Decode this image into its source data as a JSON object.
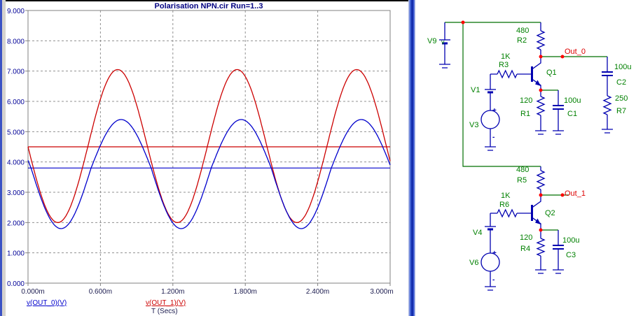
{
  "chart": {
    "title": "Polarisation NPN.cir Run=1..3",
    "x_axis_label": "T (Secs)",
    "legend": [
      {
        "label": "v(OUT_0)(V)",
        "color": "#0000cc"
      },
      {
        "label": "v(OUT_1)(V)",
        "color": "#cc0000"
      }
    ],
    "x_ticks": [
      "0.000m",
      "0.600m",
      "1.200m",
      "1.800m",
      "2.400m",
      "3.000m"
    ],
    "y_ticks": [
      "9.000",
      "8.000",
      "7.000",
      "6.000",
      "5.000",
      "4.000",
      "3.000",
      "2.000",
      "1.000",
      "0.000"
    ]
  },
  "chart_data": {
    "type": "line",
    "title": "Polarisation NPN.cir Run=1..3",
    "xlabel": "T (Secs)",
    "x_unit": "ms",
    "xlim": [
      0,
      3
    ],
    "ylim": [
      0,
      9
    ],
    "x_tick_step_ms": 0.6,
    "y_tick_step": 1.0,
    "grid": true,
    "legend_position": "bottom",
    "series": [
      {
        "name": "v(OUT_1)(V) bias (run 1)",
        "color": "#cc0000",
        "kind": "flat",
        "value_v": 4.5
      },
      {
        "name": "v(OUT_0)(V) bias (run 1)",
        "color": "#0000cc",
        "kind": "flat",
        "value_v": 3.8
      },
      {
        "name": "v(OUT_1)(V)",
        "color": "#cc0000",
        "kind": "sine",
        "mean_v": 4.5,
        "min_v": 2.0,
        "max_v": 7.05,
        "period_ms": 0.99,
        "t0_ms": 0,
        "peaks_ms": [
          0.74,
          1.73,
          2.72
        ],
        "troughs_ms": [
          0.25,
          1.24,
          2.23
        ]
      },
      {
        "name": "v(OUT_0)(V)",
        "color": "#0000cc",
        "kind": "sine",
        "mean_v": 3.8,
        "min_v": 1.8,
        "max_v": 5.4,
        "period_ms": 0.995,
        "t0_ms": 0.025,
        "peaks_ms": [
          0.77,
          1.77,
          2.76
        ],
        "troughs_ms": [
          0.27,
          1.27,
          2.26
        ]
      }
    ]
  },
  "schematic": {
    "plus_sign": "+",
    "minus_sign": "-",
    "v9": {
      "name": "V9",
      "suffix": "v"
    },
    "r2": {
      "value": "480",
      "name": "R2"
    },
    "r3": {
      "value": "1K",
      "name": "R3"
    },
    "q1": {
      "name": "Q1"
    },
    "r1": {
      "value": "120",
      "name": "R1"
    },
    "c1": {
      "value": "100u",
      "name": "C1"
    },
    "c2": {
      "value": "100u",
      "name": "C2"
    },
    "r7": {
      "value": "250",
      "name": "R7"
    },
    "v1": {
      "name": "V1"
    },
    "v3": {
      "name": "V3"
    },
    "out0": {
      "net": "Out_0"
    },
    "r5": {
      "value": "480",
      "name": "R5"
    },
    "r6": {
      "value": "1K",
      "name": "R6"
    },
    "q2": {
      "name": "Q2"
    },
    "r4": {
      "value": "120",
      "name": "R4"
    },
    "c3": {
      "value": "100u",
      "name": "C3"
    },
    "v4": {
      "name": "V4"
    },
    "v6": {
      "name": "V6"
    },
    "out1": {
      "net": "Out_1"
    }
  }
}
